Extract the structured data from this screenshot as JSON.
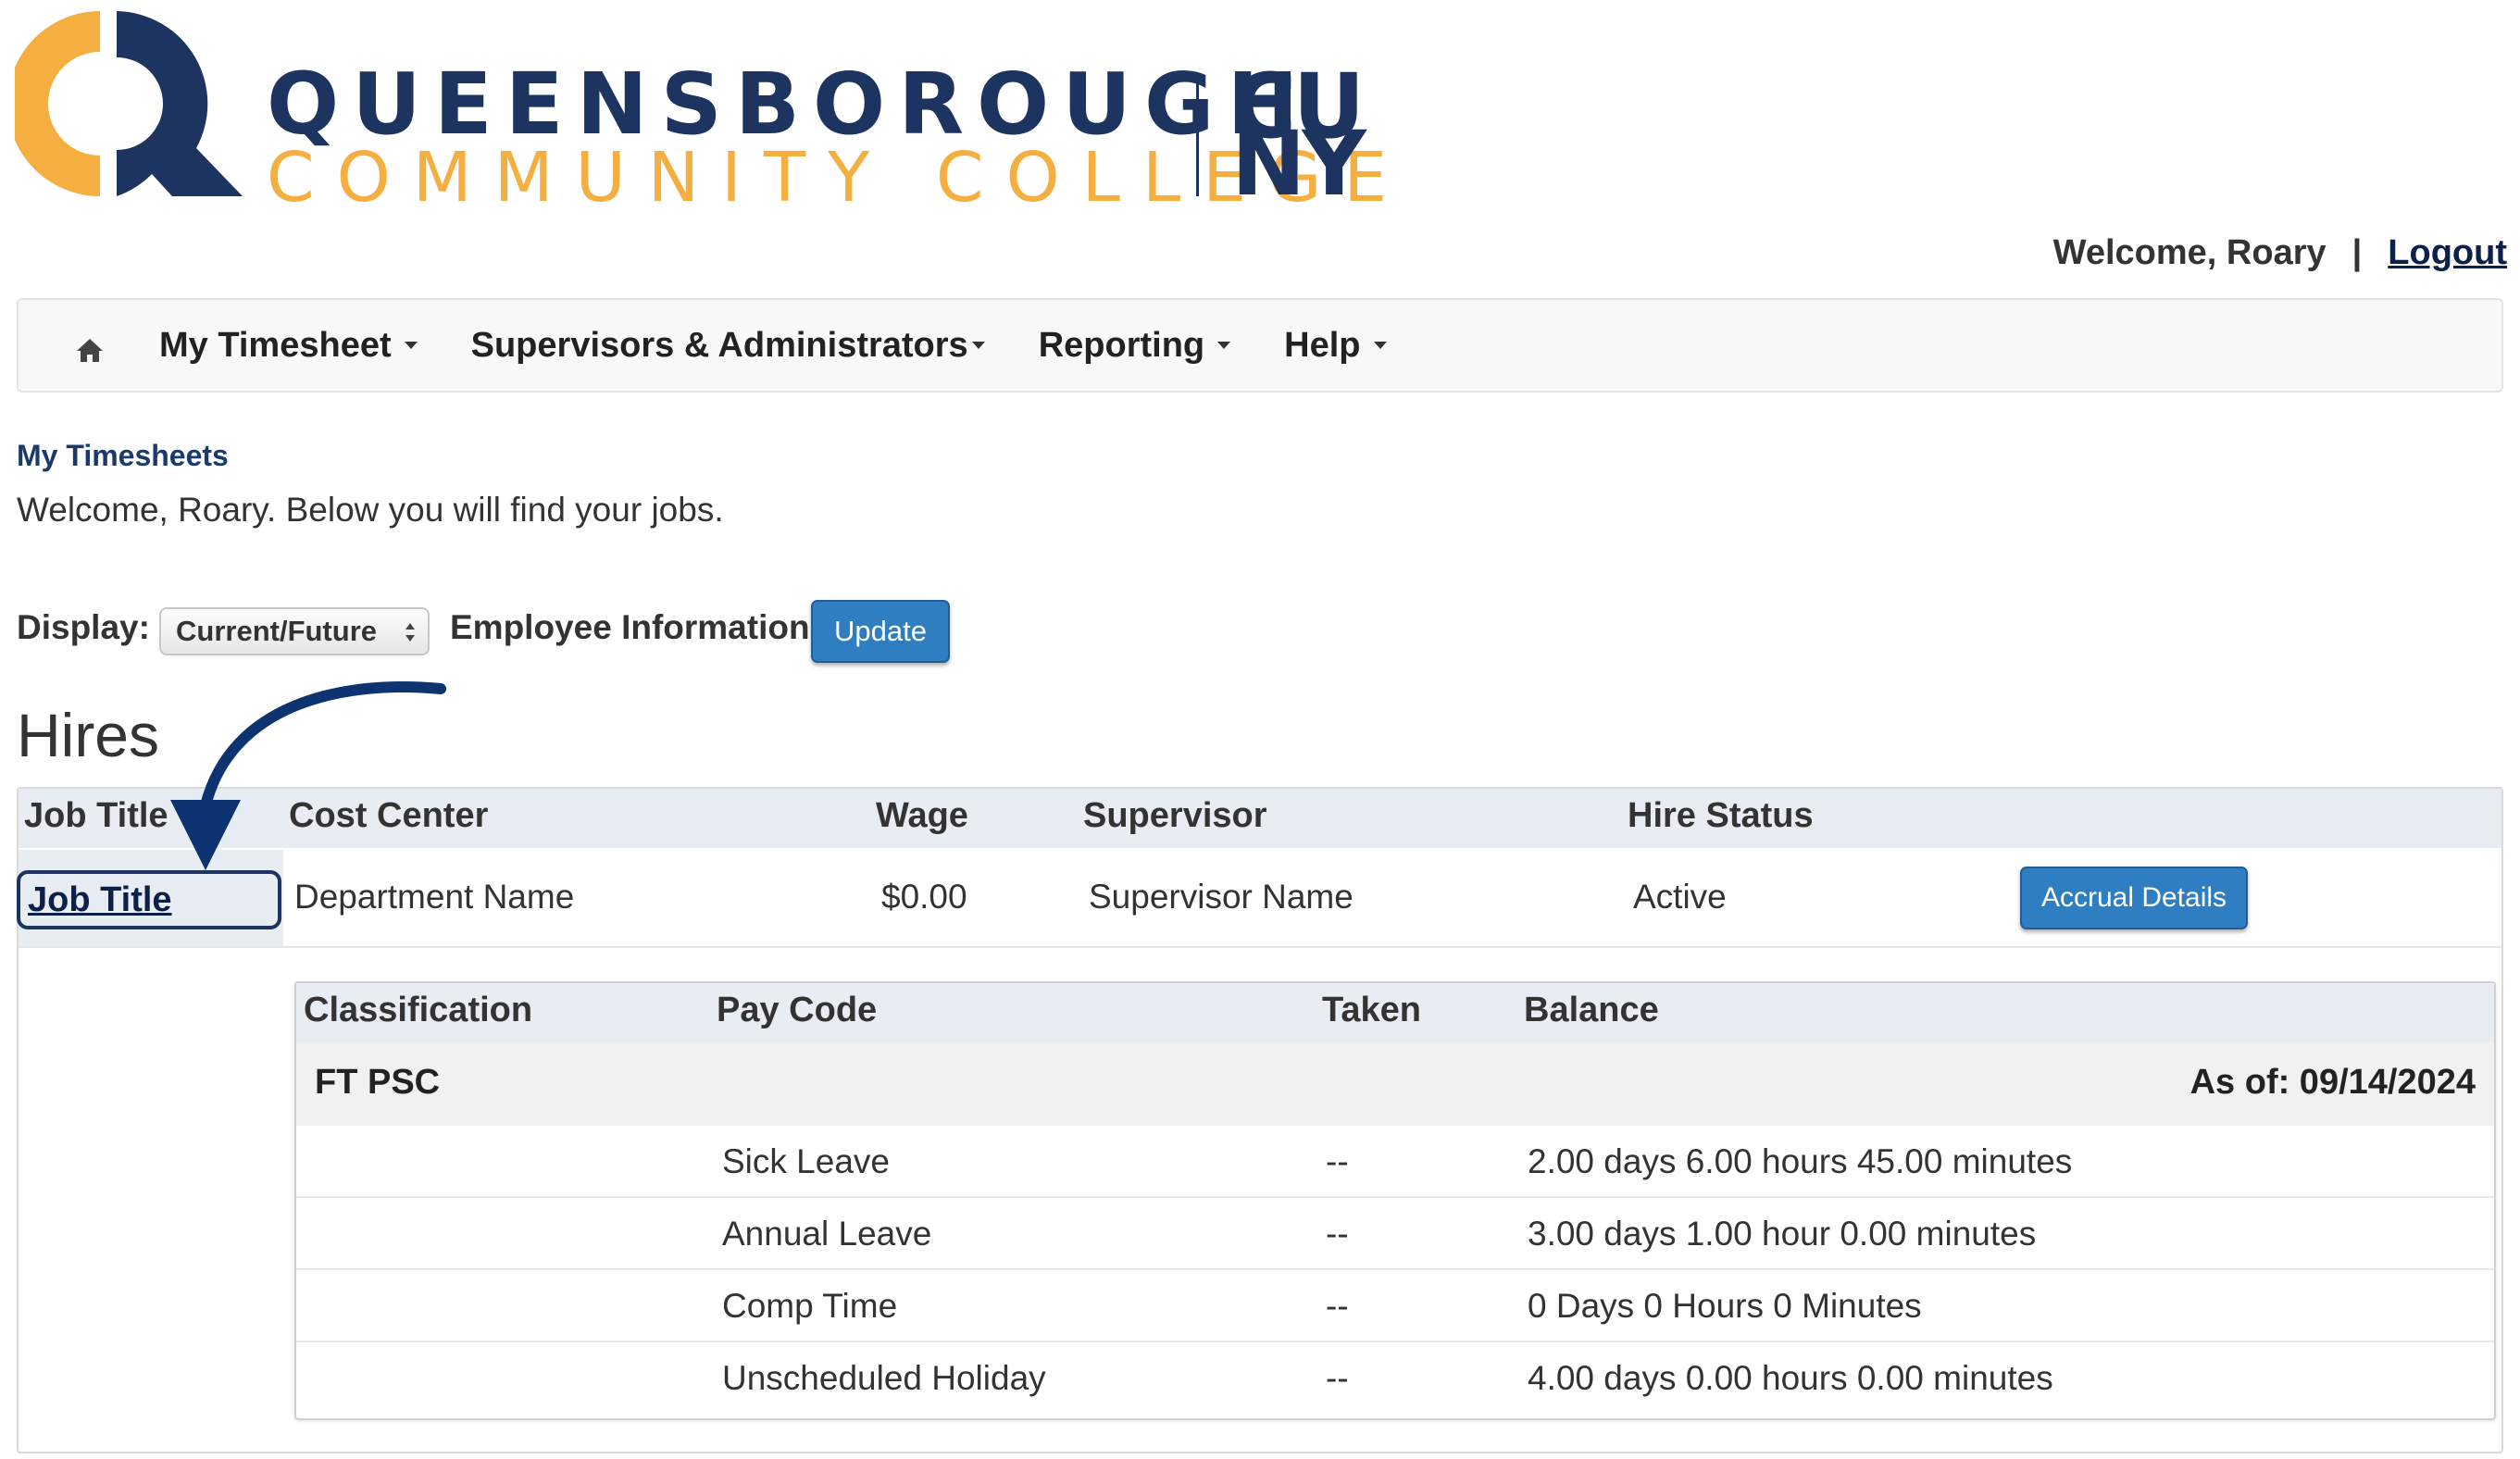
{
  "logo": {
    "line1": "QUEENSBOROUGH",
    "line2": "COMMUNITY COLLEGE",
    "cuny_top": "CU",
    "cuny_bottom": "NY",
    "primary_color": "#1d3461",
    "accent_color": "#f5ae40"
  },
  "header": {
    "welcome": "Welcome, Roary",
    "separator": "|",
    "logout_label": "Logout"
  },
  "navbar": {
    "home_icon": "home-icon",
    "items": [
      {
        "label": "My Timesheet"
      },
      {
        "label": "Supervisors & Administrators"
      },
      {
        "label": "Reporting"
      },
      {
        "label": "Help"
      }
    ]
  },
  "page": {
    "breadcrumb": "My Timesheets",
    "intro": "Welcome, Roary. Below you will find your jobs."
  },
  "filters": {
    "display_label": "Display:",
    "display_value": "Current/Future",
    "employee_info_label": "Employee Information",
    "update_label": "Update"
  },
  "hires": {
    "heading": "Hires",
    "columns": [
      "Job Title",
      "Cost Center",
      "Wage",
      "Supervisor",
      "Hire Status"
    ],
    "row": {
      "job_title": "Job Title",
      "cost_center": "Department Name",
      "wage": "$0.00",
      "supervisor": "Supervisor Name",
      "hire_status": "Active",
      "action_label": "Accrual Details"
    }
  },
  "accruals": {
    "columns": [
      "Classification",
      "Pay Code",
      "Taken",
      "Balance"
    ],
    "group": "FT PSC",
    "as_of": "As of: 09/14/2024",
    "rows": [
      {
        "pay_code": "Sick Leave",
        "taken": "--",
        "balance": "2.00 days 6.00 hours 45.00 minutes"
      },
      {
        "pay_code": "Annual Leave",
        "taken": "--",
        "balance": "3.00 days 1.00 hour 0.00 minutes"
      },
      {
        "pay_code": "Comp Time",
        "taken": "--",
        "balance": "0 Days 0 Hours 0 Minutes"
      },
      {
        "pay_code": "Unscheduled Holiday",
        "taken": "--",
        "balance": "4.00 days 0.00 hours 0.00 minutes"
      }
    ]
  },
  "annotation": {
    "arrow_icon": "curved-arrow-icon",
    "arrow_color": "#0d3470"
  }
}
